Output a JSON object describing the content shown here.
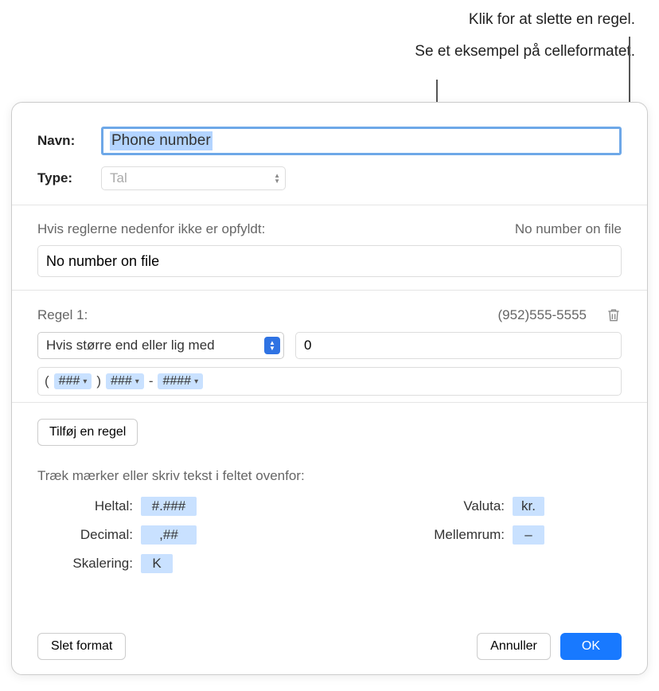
{
  "callouts": {
    "delete": "Klik for at slette en regel.",
    "preview": "Se et eksempel på celleformatet."
  },
  "form": {
    "name_label": "Navn:",
    "name_value": "Phone number",
    "type_label": "Type:",
    "type_value": "Tal"
  },
  "fallback": {
    "label": "Hvis reglerne nedenfor ikke er opfyldt:",
    "preview": "No number on file",
    "value": "No number on file"
  },
  "rule": {
    "title": "Regel 1:",
    "preview": "(952)555-5555",
    "condition_label": "Hvis større end eller lig med",
    "condition_value": "0",
    "tokens": {
      "p1": "(",
      "t1": "###",
      "p2": ")",
      "t2": "###",
      "p3": "-",
      "t3": "####"
    }
  },
  "add_rule": "Tilføj en regel",
  "drag_hint": "Træk mærker eller skriv tekst i feltet ovenfor:",
  "token_palette": {
    "integer_label": "Heltal:",
    "integer_value": "#.###",
    "decimal_label": "Decimal:",
    "decimal_value": ",##",
    "scale_label": "Skalering:",
    "scale_value": "K",
    "currency_label": "Valuta:",
    "currency_value": "kr.",
    "space_label": "Mellemrum:",
    "space_value": "–"
  },
  "footer": {
    "delete_format": "Slet format",
    "cancel": "Annuller",
    "ok": "OK"
  }
}
